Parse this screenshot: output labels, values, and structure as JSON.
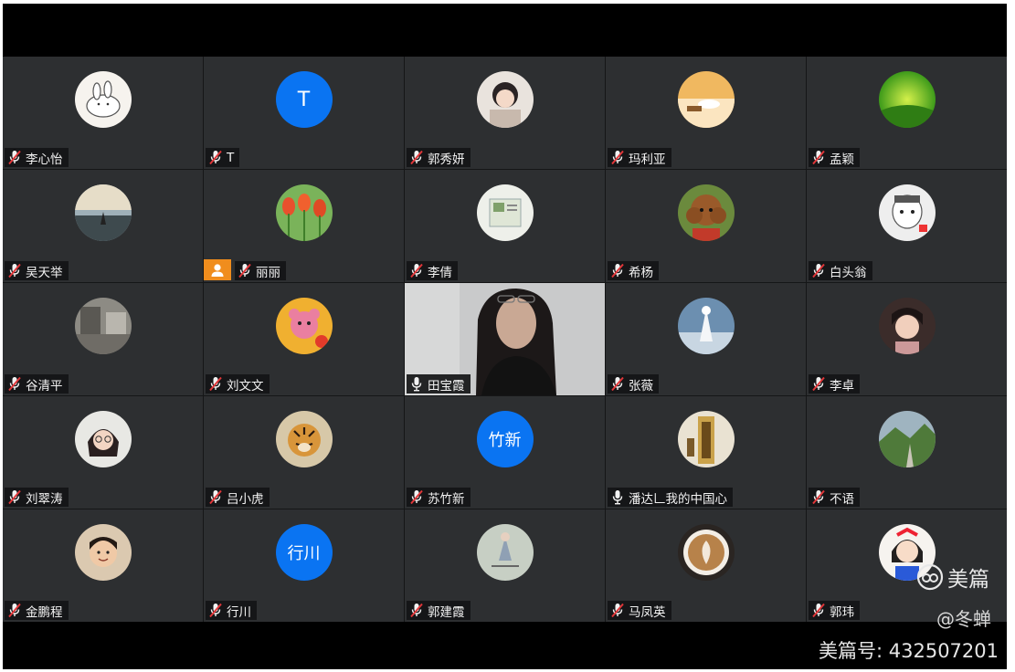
{
  "participants": [
    {
      "name": "李心怡",
      "mic": "muted",
      "avatar": {
        "type": "image",
        "icon": "cartoon-rabbit-icon"
      }
    },
    {
      "name": "T",
      "mic": "muted",
      "avatar": {
        "type": "initials",
        "text": "T",
        "color": "#0a74f2"
      }
    },
    {
      "name": "郭秀妍",
      "mic": "muted",
      "avatar": {
        "type": "image",
        "icon": "anime-girl-icon"
      }
    },
    {
      "name": "玛利亚",
      "mic": "muted",
      "avatar": {
        "type": "image",
        "icon": "cup-photo-icon"
      }
    },
    {
      "name": "孟颖",
      "mic": "muted",
      "avatar": {
        "type": "image",
        "icon": "green-tea-icon"
      }
    },
    {
      "name": "吴天举",
      "mic": "muted",
      "avatar": {
        "type": "image",
        "icon": "sunset-sea-icon"
      }
    },
    {
      "name": "丽丽",
      "mic": "muted",
      "host": true,
      "avatar": {
        "type": "image",
        "icon": "tulips-icon"
      }
    },
    {
      "name": "李倩",
      "mic": "muted",
      "avatar": {
        "type": "image",
        "icon": "book-photo-icon"
      }
    },
    {
      "name": "希杨",
      "mic": "muted",
      "avatar": {
        "type": "image",
        "icon": "poodle-icon"
      }
    },
    {
      "name": "白头翁",
      "mic": "muted",
      "avatar": {
        "type": "image",
        "icon": "cartoon-face-icon"
      }
    },
    {
      "name": "谷清平",
      "mic": "muted",
      "avatar": {
        "type": "image",
        "icon": "street-photo-icon"
      }
    },
    {
      "name": "刘文文",
      "mic": "muted",
      "avatar": {
        "type": "image",
        "icon": "toy-bear-icon"
      }
    },
    {
      "name": "田宝霞",
      "mic": "on",
      "video": true,
      "active": true
    },
    {
      "name": "张薇",
      "mic": "muted",
      "avatar": {
        "type": "image",
        "icon": "snow-figure-icon"
      }
    },
    {
      "name": "李卓",
      "mic": "muted",
      "avatar": {
        "type": "image",
        "icon": "girl-portrait-icon"
      }
    },
    {
      "name": "刘翠涛",
      "mic": "muted",
      "avatar": {
        "type": "image",
        "icon": "glasses-girl-icon"
      }
    },
    {
      "name": "吕小虎",
      "mic": "muted",
      "avatar": {
        "type": "image",
        "icon": "tiger-icon"
      }
    },
    {
      "name": "苏竹新",
      "mic": "muted",
      "avatar": {
        "type": "initials",
        "text": "竹新",
        "color": "#0a74f2"
      }
    },
    {
      "name": "潘达𠃊我的中国心",
      "mic": "on",
      "avatar": {
        "type": "image",
        "icon": "bamboo-sign-icon"
      }
    },
    {
      "name": "不语",
      "mic": "muted",
      "avatar": {
        "type": "image",
        "icon": "mountain-road-icon"
      }
    },
    {
      "name": "金鹏程",
      "mic": "muted",
      "avatar": {
        "type": "image",
        "icon": "boy-portrait-icon"
      }
    },
    {
      "name": "行川",
      "mic": "muted",
      "avatar": {
        "type": "initials",
        "text": "行川",
        "color": "#0a74f2"
      }
    },
    {
      "name": "郭建霞",
      "mic": "muted",
      "avatar": {
        "type": "image",
        "icon": "dancer-icon"
      }
    },
    {
      "name": "马凤英",
      "mic": "muted",
      "avatar": {
        "type": "image",
        "icon": "latte-art-icon"
      }
    },
    {
      "name": "郭玮",
      "mic": "muted",
      "avatar": {
        "type": "image",
        "icon": "princess-cartoon-icon"
      }
    }
  ],
  "watermark": {
    "brand": "美篇",
    "user": "@冬蝉",
    "id": "美篇号: 432507201"
  },
  "colors": {
    "tile_bg": "#2d2f31",
    "initials_bg": "#0a74f2",
    "host_badge": "#f08d1d",
    "muted_red": "#e2373a",
    "active_border": "#2fae6a"
  }
}
